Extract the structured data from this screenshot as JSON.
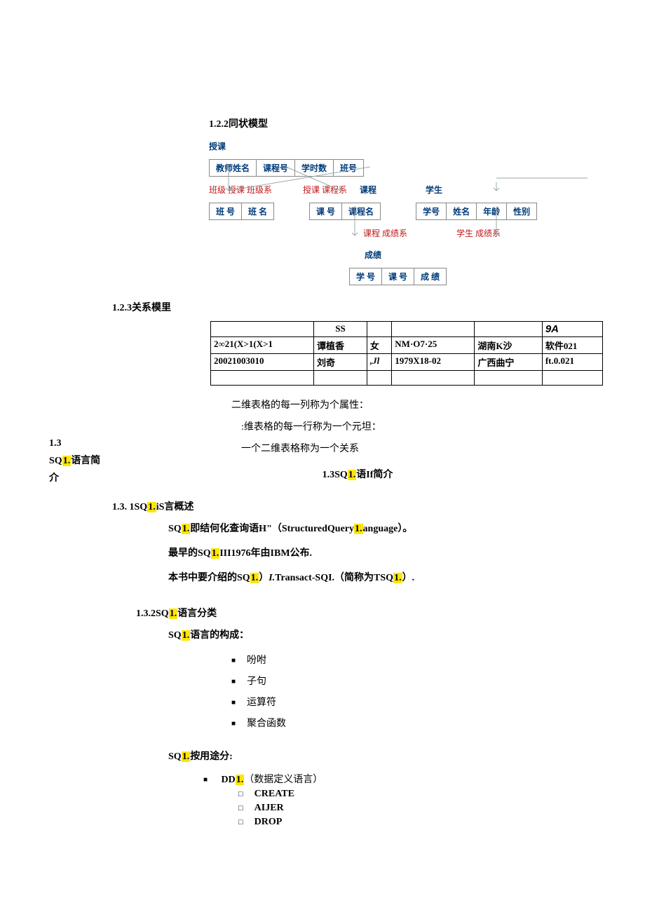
{
  "sections": {
    "s122": "1.2.2同状模型",
    "s123": "1.2.3关系模里",
    "s13center": {
      "pre": "1.3SQ",
      "hl": "1.",
      "post": "语If简介"
    },
    "s131": {
      "pre": "1.3.   1SQ",
      "hl": "1.",
      "post": "iS言概述"
    },
    "s132": {
      "pre": "1.3.2SQ",
      "hl": "1.",
      "post": "语言分类"
    }
  },
  "sidebar": {
    "l1": "1.3",
    "l2a": "SQ",
    "l2hl": "1.",
    "l2b": "语言简",
    "l3": "介"
  },
  "diagram": {
    "top_label": "授课",
    "box1": [
      "教师姓名",
      "课程号",
      "学时数",
      "班号"
    ],
    "midrow": {
      "left_red": "班级 授课 班级系",
      "mid_red": "授课 课程系",
      "mid_blue": "课程",
      "right_blue": "学生"
    },
    "box_left": [
      "班 号",
      "班 名"
    ],
    "box_mid": [
      "课 号",
      "课程名"
    ],
    "box_right": [
      "学号",
      "姓名",
      "年龄",
      "性别"
    ],
    "lowrow": {
      "left_red": "课程 成绩系",
      "right_red": "学生 成绩系",
      "blue": "成绩"
    },
    "box_bottom": [
      "学 号",
      "课 号",
      "成 绩"
    ]
  },
  "rel_table": {
    "header": [
      "",
      "SS",
      "",
      "",
      "",
      "9A"
    ],
    "rows": [
      [
        "2∞21(X>1(X>1",
        "谭植香",
        "女",
        "NM·O7·25",
        "湖南K沙",
        "软件021"
      ],
      [
        "20021003010",
        "刘奇",
        ",Jl",
        "1979X18-02",
        "广西曲宁",
        "ft.0.021"
      ],
      [
        "",
        "",
        "",
        "",
        "",
        ""
      ]
    ]
  },
  "bullets_after_table": [
    "二维表格的每一列称为个属性：",
    ":维表格的每一行称为一个元坦：",
    "一个二维表格称为一个关系"
  ],
  "p131": {
    "l1": {
      "pre": "SQ",
      "hl": "1.",
      "post": "即结何化查询语H\"（StructuredQuery",
      "hl2": "1.",
      "post2": "anguage）。"
    },
    "l2": {
      "pre": "最早的SQ",
      "hl": "1.",
      "post": "III1976年由IBM公布."
    },
    "l3": {
      "pre": "本书中要介绍的SQ",
      "hl": "1.",
      "mid": "）",
      "ital": "I.",
      "post": "Transact-SQI.（简称为TSQ",
      "hl2": "1.",
      "post2": "）."
    }
  },
  "p132_intro": {
    "pre": "SQ",
    "hl": "1.",
    "post": "语言的构成："
  },
  "p132_list": [
    "吩咐",
    "子句",
    "运算符",
    "聚合函数"
  ],
  "p132_use": {
    "pre": "SQ",
    "hl": "1.",
    "post": "按用途分:"
  },
  "ddl": {
    "pre": "DD",
    "hl": "1.",
    "post": "（数据定义语言）"
  },
  "ddl_items": [
    "CREATE",
    "AIJER",
    "DROP"
  ]
}
